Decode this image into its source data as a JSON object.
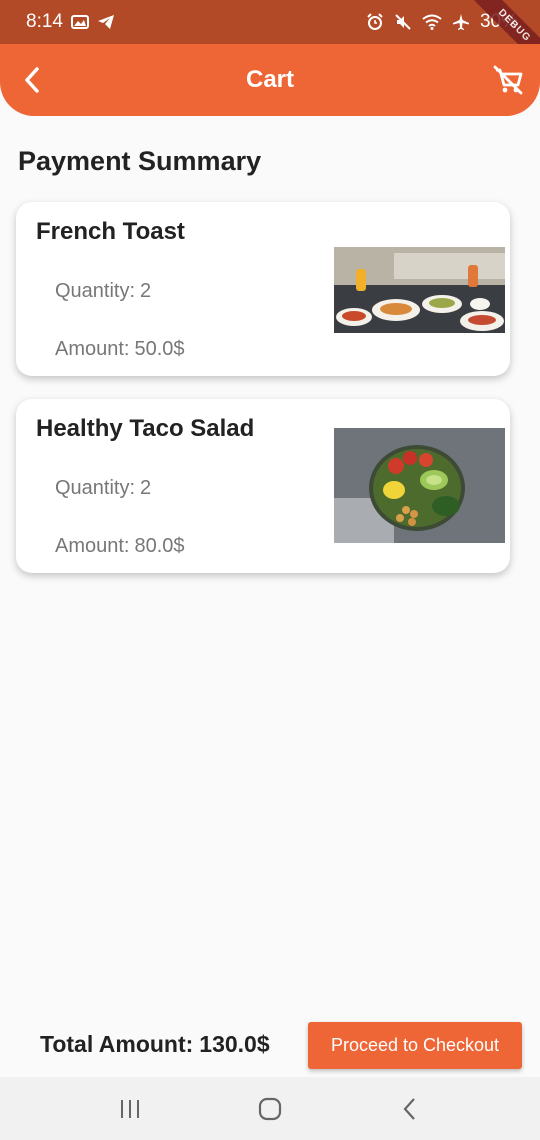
{
  "status_bar": {
    "time": "8:14",
    "battery": "30%",
    "debug_label": "DEBUG"
  },
  "app_bar": {
    "title": "Cart",
    "back_icon": "chevron-left-icon",
    "action_icon": "remove-shopping-cart-icon"
  },
  "summary": {
    "title": "Payment Summary"
  },
  "cart_items": [
    {
      "name": "French Toast",
      "quantity_label": "Quantity:",
      "quantity": "2",
      "amount_label": "Amount:",
      "amount": "50.0$",
      "image": "french-toast-photo"
    },
    {
      "name": "Healthy Taco Salad",
      "quantity_label": "Quantity:",
      "quantity": "2",
      "amount_label": "Amount:",
      "amount": "80.0$",
      "image": "taco-salad-photo"
    }
  ],
  "footer": {
    "total_label": "Total Amount:",
    "total_value": "130.0$",
    "checkout_label": "Proceed to Checkout"
  },
  "colors": {
    "accent": "#ee6536",
    "status_bar": "#b34a27",
    "background": "#fafafa"
  }
}
